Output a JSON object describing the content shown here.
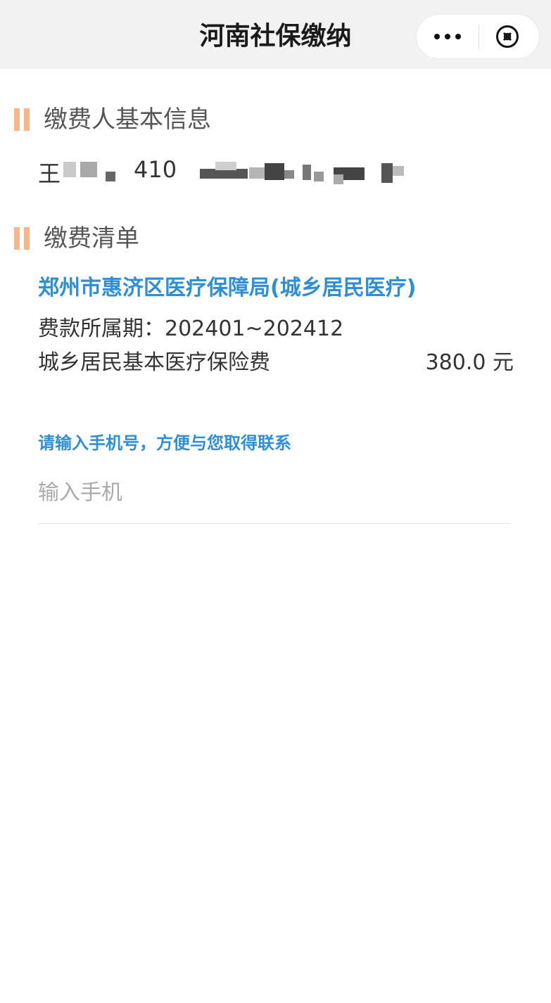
{
  "header": {
    "title": "河南社保缴纳",
    "more_icon": "more-dots-icon",
    "close_icon": "close-circle-icon"
  },
  "payer_section": {
    "title": "缴费人基本信息",
    "name_visible": "王",
    "id_visible": "410"
  },
  "bill_section": {
    "title": "缴费清单",
    "organization": "郑州市惠济区医疗保障局(城乡居民医疗)",
    "period_label": "费款所属期：",
    "period_value": "202401~202412",
    "fee_name": "城乡居民基本医疗保险费",
    "fee_amount": "380.0 元"
  },
  "contact": {
    "prompt": "请输入手机号，方便与您取得联系",
    "phone_placeholder": "输入手机",
    "phone_value": ""
  },
  "colors": {
    "accent_blue": "#2e8fd6",
    "section_bar": "#f6b68a",
    "header_bg": "#f2f2f2"
  }
}
